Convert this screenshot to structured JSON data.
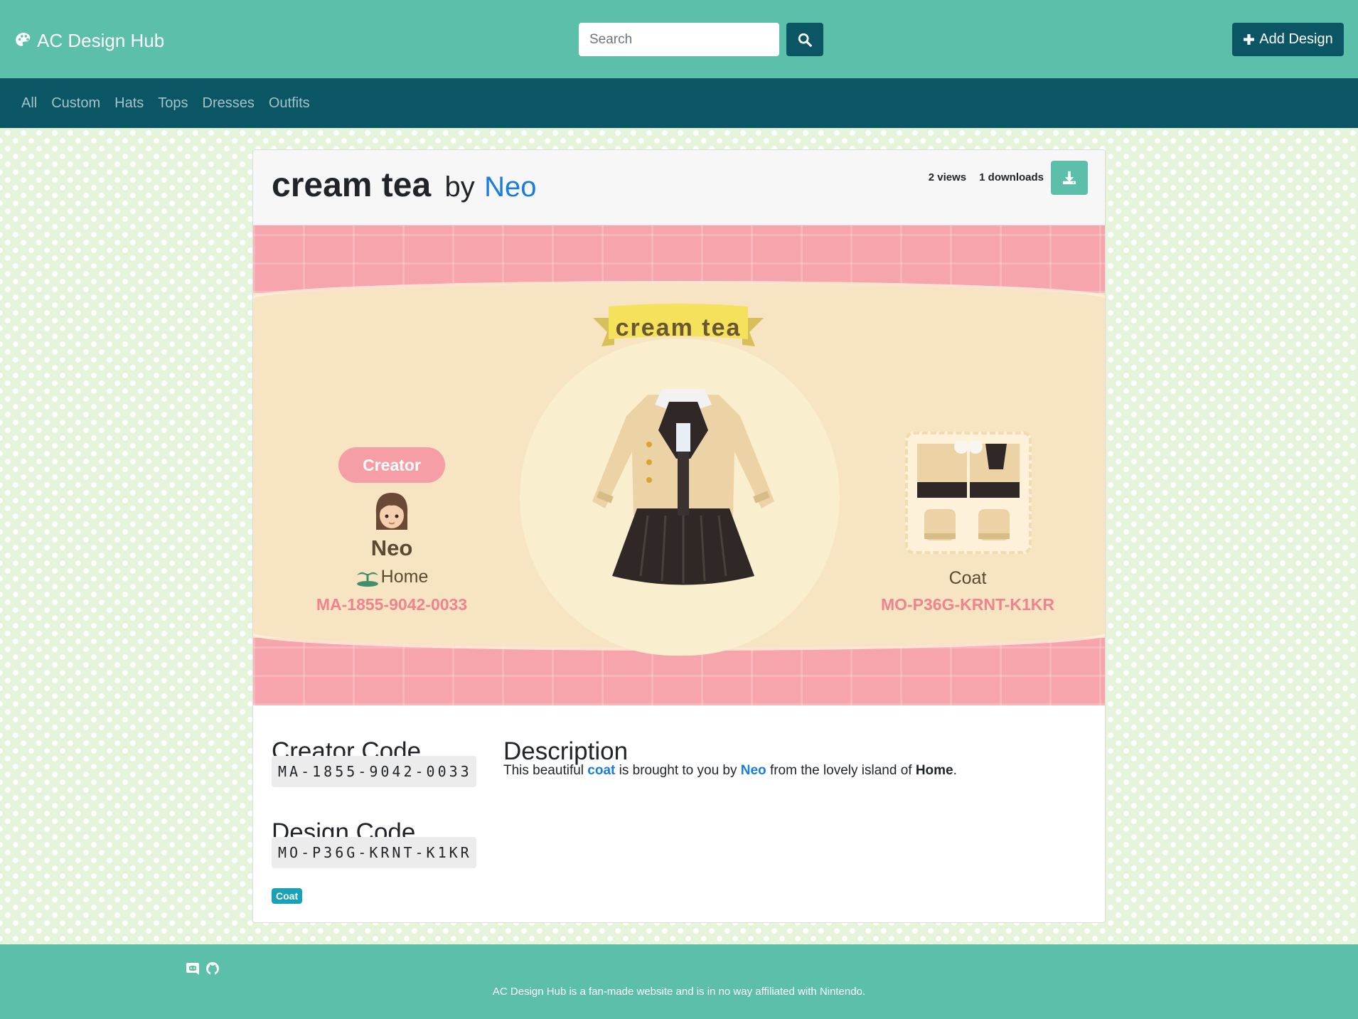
{
  "app": {
    "brand": "AC Design Hub",
    "brand_icon": "palette-icon"
  },
  "header": {
    "search_placeholder": "Search",
    "search_icon": "search-icon",
    "add_button_label": "Add Design",
    "add_icon": "plus-icon"
  },
  "categories": [
    "All",
    "Custom",
    "Hats",
    "Tops",
    "Dresses",
    "Outfits"
  ],
  "design": {
    "title": "cream tea",
    "by": "by",
    "author": "Neo",
    "views": "2 views",
    "downloads": "1 downloads",
    "download_icon": "download-icon"
  },
  "design_image": {
    "banner_text": "cream tea",
    "creator_pill": "Creator",
    "creator_name": "Neo",
    "island": "Home",
    "creator_code": "MA-1855-9042-0033",
    "type": "Coat",
    "design_code": "MO-P36G-KRNT-K1KR"
  },
  "details": {
    "creator_code_heading": "Creator Code",
    "creator_code": "MA-1855-9042-0033",
    "design_code_heading": "Design Code",
    "design_code": "MO-P36G-KRNT-K1KR",
    "description_heading": "Description",
    "description": {
      "pre": "This beautiful ",
      "type": "coat",
      "mid": " is brought to you by ",
      "author": "Neo",
      "mid2": " from the lovely island of ",
      "island": "Home",
      "end": "."
    },
    "tag": "Coat"
  },
  "footer": {
    "icons": [
      "discord-icon",
      "github-icon"
    ],
    "text": "AC Design Hub is a fan-made website and is in no way affiliated with Nintendo."
  },
  "colors": {
    "primary_teal": "#5bbfaa",
    "dark_teal": "#0a5664",
    "link_blue": "#1a7dde",
    "pink": "#f7a5ac",
    "badge_cyan": "#17a2b8"
  }
}
